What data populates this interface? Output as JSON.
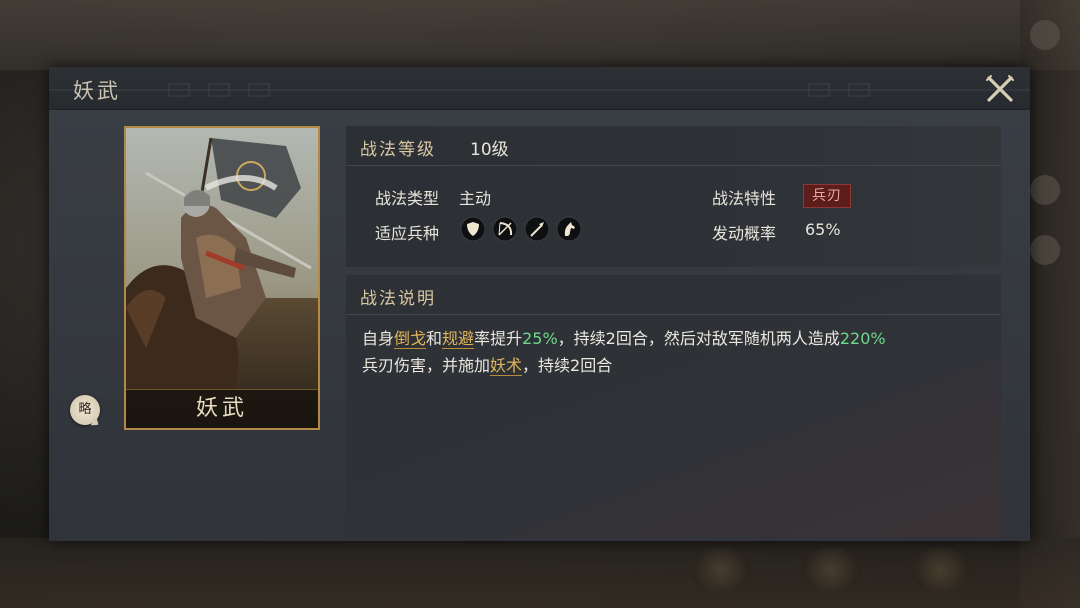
{
  "dialog": {
    "title": "妖武"
  },
  "card": {
    "name": "妖武",
    "badge": "略"
  },
  "stats": {
    "level_label": "战法等级",
    "level_value": "10级",
    "type_label": "战法类型",
    "type_value": "主动",
    "units_label": "适应兵种",
    "units": [
      "shield-icon",
      "bow-icon",
      "spear-icon",
      "horse-icon"
    ],
    "trait_label": "战法特性",
    "trait_value": "兵刃",
    "rate_label": "发动概率",
    "rate_value": "65%"
  },
  "description": {
    "heading": "战法说明",
    "segments": {
      "s1": "自身",
      "k1": "倒戈",
      "s2": "和",
      "k2": "规避",
      "s3": "率提升",
      "n1": "25%",
      "s4": "，持续2回合，然后对敌军随机两人造成",
      "n2": "220%",
      "s5": "兵刃伤害，并施加",
      "k3": "妖术",
      "s6": "，持续2回合"
    }
  },
  "colors": {
    "gold": "#d9c7a2",
    "highlight_gold": "#e0b45c",
    "highlight_green": "#6ed98a",
    "trait_red": "#5e1d1c"
  }
}
